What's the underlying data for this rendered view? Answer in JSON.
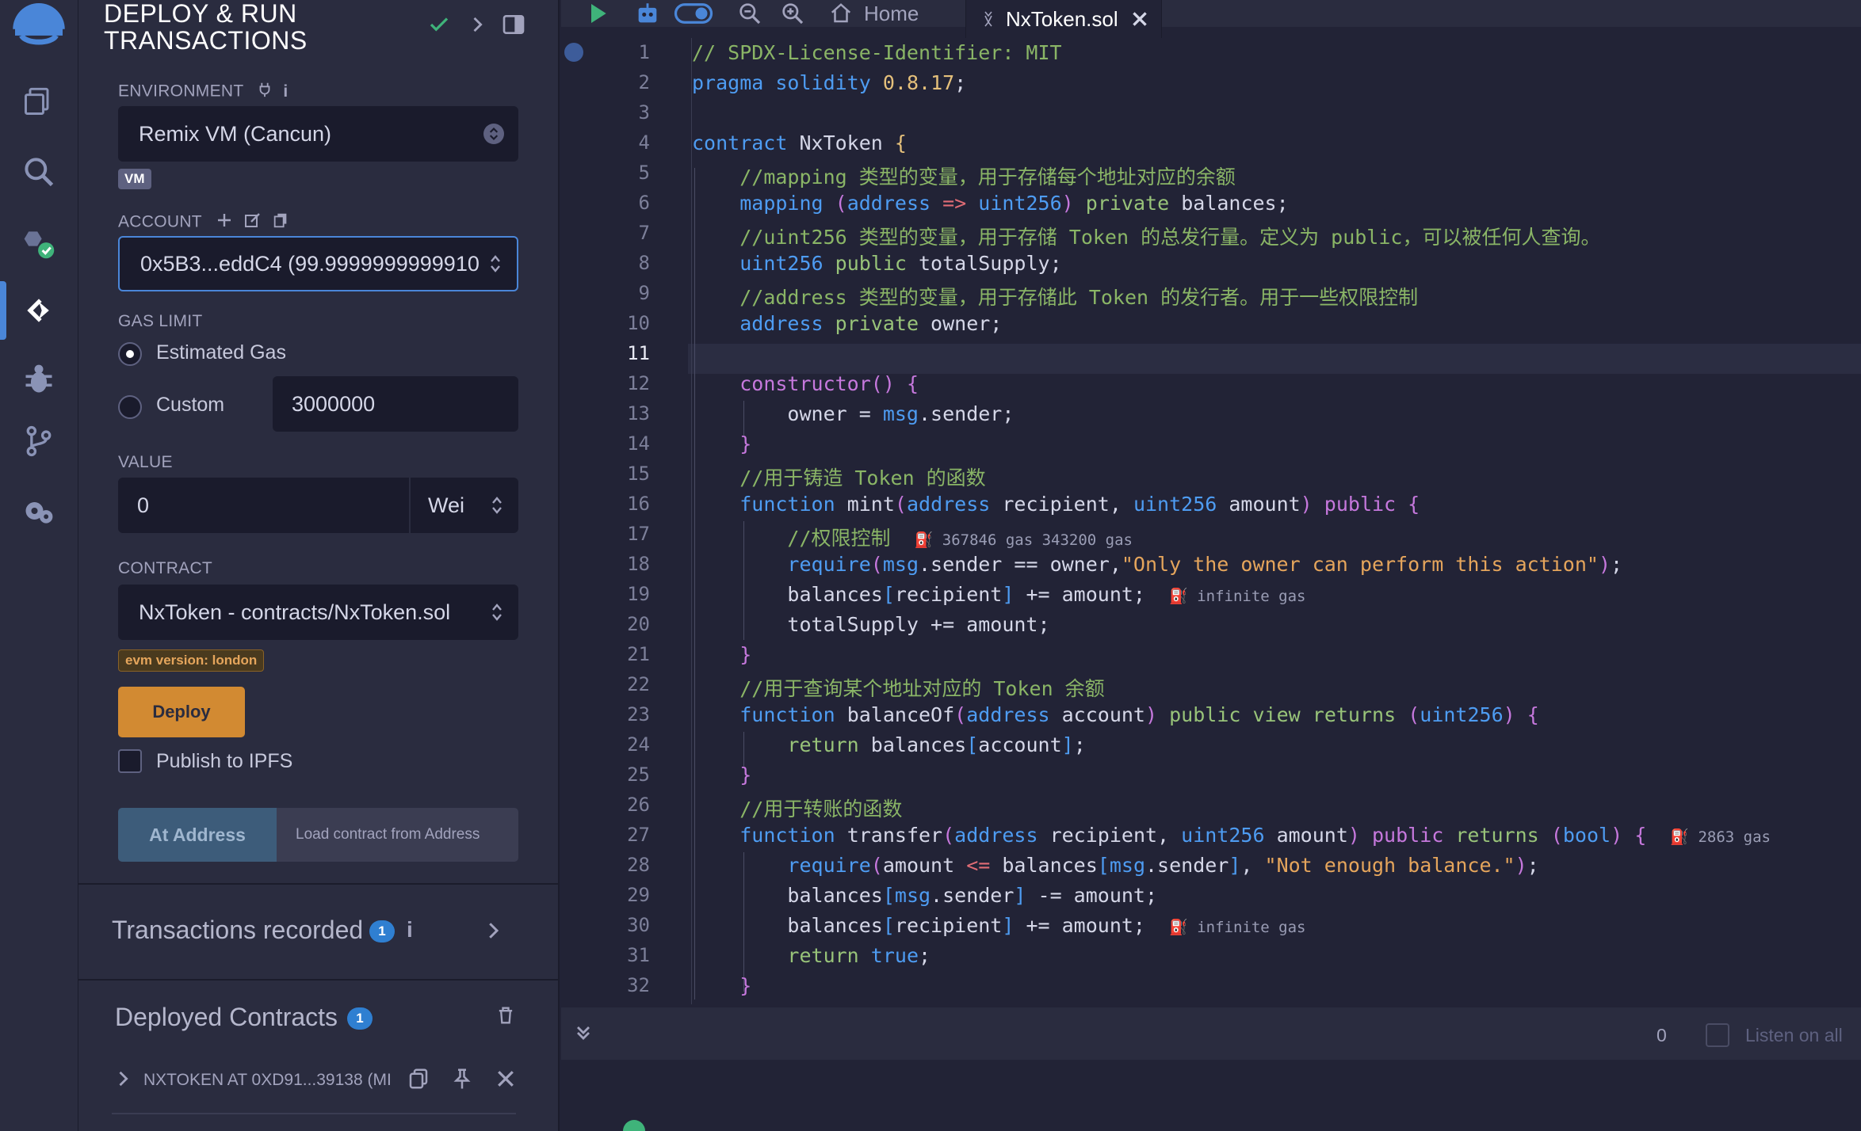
{
  "panel": {
    "title_line1": "DEPLOY & RUN",
    "title_line2": "TRANSACTIONS",
    "environment_label": "ENVIRONMENT",
    "environment_value": "Remix VM (Cancun)",
    "vm_badge": "VM",
    "account_label": "ACCOUNT",
    "account_value": "0x5B3...eddC4 (99.9999999999910",
    "gas_limit_label": "GAS LIMIT",
    "gas_estimated": "Estimated Gas",
    "gas_custom": "Custom",
    "gas_custom_value": "3000000",
    "value_label": "VALUE",
    "value_amount": "0",
    "value_unit": "Wei",
    "contract_label": "CONTRACT",
    "contract_value": "NxToken - contracts/NxToken.sol",
    "evm_badge": "evm version: london",
    "deploy_button": "Deploy",
    "publish_ipfs": "Publish to IPFS",
    "at_address_button": "At Address",
    "load_contract_placeholder": "Load contract from Address",
    "transactions_recorded": "Transactions recorded",
    "transactions_count": "1",
    "deployed_contracts": "Deployed Contracts",
    "deployed_count": "1",
    "deployed_item": "NXTOKEN AT 0XD91...39138 (MI"
  },
  "tabs": {
    "home": "Home",
    "file": "NxToken.sol"
  },
  "editor": {
    "line_numbers": [
      "1",
      "2",
      "3",
      "4",
      "5",
      "6",
      "7",
      "8",
      "9",
      "10",
      "11",
      "12",
      "13",
      "14",
      "15",
      "16",
      "17",
      "18",
      "19",
      "20",
      "21",
      "22",
      "23",
      "24",
      "25",
      "26",
      "27",
      "28",
      "29",
      "30",
      "31",
      "32"
    ],
    "gas_17": "367846 gas 343200 gas",
    "gas_19": "infinite gas",
    "gas_27": "2863 gas",
    "gas_30": "infinite gas"
  },
  "terminal": {
    "count": "0",
    "listen_label": "Listen on all"
  },
  "colors": {
    "accent": "#d28a32",
    "panel_bg": "#2a2c3f",
    "editor_bg": "#222336",
    "badge_blue": "#2f7fd1"
  }
}
